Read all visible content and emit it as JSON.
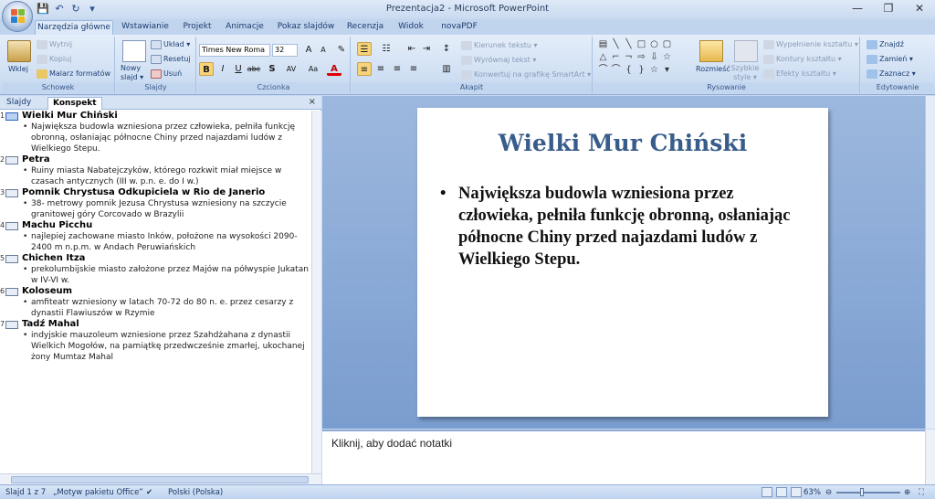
{
  "window": {
    "title": "Prezentacja2 - Microsoft PowerPoint",
    "minimize": "—",
    "maximize": "❐",
    "close": "✕"
  },
  "qat": {
    "save": "💾",
    "undo": "↶",
    "redo": "↻",
    "more": "▾"
  },
  "tabs": [
    "Narzędzia główne",
    "Wstawianie",
    "Projekt",
    "Animacje",
    "Pokaz slajdów",
    "Recenzja",
    "Widok",
    "novaPDF"
  ],
  "ribbon": {
    "clipboard": {
      "label": "Schowek",
      "paste": "Wklej",
      "cut": "Wytnij",
      "copy": "Kopiuj",
      "format_painter": "Malarz formatów"
    },
    "slides": {
      "label": "Slajdy",
      "new_slide": "Nowy slajd ▾",
      "layout": "Układ ▾",
      "reset": "Resetuj",
      "delete": "Usuń"
    },
    "font": {
      "label": "Czcionka",
      "font_name": "Times New Roma",
      "font_size": "32",
      "grow": "A",
      "shrink": "A",
      "clear": "✎",
      "bold": "B",
      "italic": "I",
      "underline": "U",
      "strike": "abc",
      "shadow": "S",
      "spacing": "AV",
      "case": "Aa",
      "color": "A"
    },
    "paragraph": {
      "label": "Akapit",
      "text_direction": "Kierunek tekstu ▾",
      "align_text": "Wyrównaj tekst ▾",
      "smartart": "Konwertuj na grafikę SmartArt ▾"
    },
    "drawing": {
      "label": "Rysowanie",
      "arrange": "Rozmieść",
      "quick_styles": "Szybkie style ▾",
      "fill": "Wypełnienie kształtu ▾",
      "outline": "Kontury kształtu ▾",
      "effects": "Efekty kształtu ▾"
    },
    "editing": {
      "label": "Edytowanie",
      "find": "Znajdź",
      "replace": "Zamień ▾",
      "select": "Zaznacz ▾"
    }
  },
  "panel": {
    "tab_slides": "Slajdy",
    "tab_outline": "Konspekt",
    "close": "×"
  },
  "outline": [
    {
      "num": "1",
      "title": "Wielki Mur Chiński",
      "lines": [
        "Największa budowla wzniesiona przez człowieka, pełniła funkcję",
        "obronną, osłaniając północne  Chiny przed najazdami ludów z",
        "Wielkiego Stepu."
      ]
    },
    {
      "num": "2",
      "title": "Petra",
      "lines": [
        "Ruiny miasta Nabatejczyków, którego rozkwit miał miejsce w",
        "czasach antycznych (III w. p.n. e. do I w.)"
      ]
    },
    {
      "num": "3",
      "title": "Pomnik Chrystusa Odkupiciela w Rio de Janerio",
      "lines": [
        "38- metrowy pomnik Jezusa Chrystusa wzniesiony na szczycie",
        "granitowej góry Corcovado w Brazylii"
      ]
    },
    {
      "num": "4",
      "title": "Machu Picchu",
      "lines": [
        "najlepiej zachowane miasto Inków, położone na wysokości 2090-",
        "2400 m n.p.m. w Andach Peruwiańskich"
      ]
    },
    {
      "num": "5",
      "title": "Chichen Itza",
      "lines": [
        "prekolumbijskie miasto założone przez Majów na półwyspie Jukatan",
        "w IV-VI w."
      ]
    },
    {
      "num": "6",
      "title": "Koloseum",
      "lines": [
        "amfiteatr wzniesiony w latach 70-72  do 80 n. e. przez cesarzy z",
        "dynastii Flawiuszów w Rzymie"
      ]
    },
    {
      "num": "7",
      "title": "Tadź Mahal",
      "lines": [
        "indyjskie mauzoleum  wzniesione przez Szahdżahana  z dynastii",
        "Wielkich Mogołów, na pamiątkę przedwcześnie zmarłej, ukochanej",
        "żony Mumtaz  Mahal"
      ]
    }
  ],
  "slide": {
    "title": "Wielki Mur Chiński",
    "body": "Największa budowla wzniesiona przez człowieka, pełniła funkcję obronną, osłaniając północne Chiny przed najazdami ludów z Wielkiego Stepu."
  },
  "notes": {
    "placeholder": "Kliknij, aby dodać notatki"
  },
  "status": {
    "slide_info": "Slajd 1 z 7",
    "theme": "„Motyw pakietu Office”",
    "language": "Polski (Polska)",
    "zoom": "63%"
  },
  "colors": {
    "accent": "#385d8a",
    "ribbon_bg": "#dde9f8",
    "slide_area": "#7a9dcf"
  }
}
